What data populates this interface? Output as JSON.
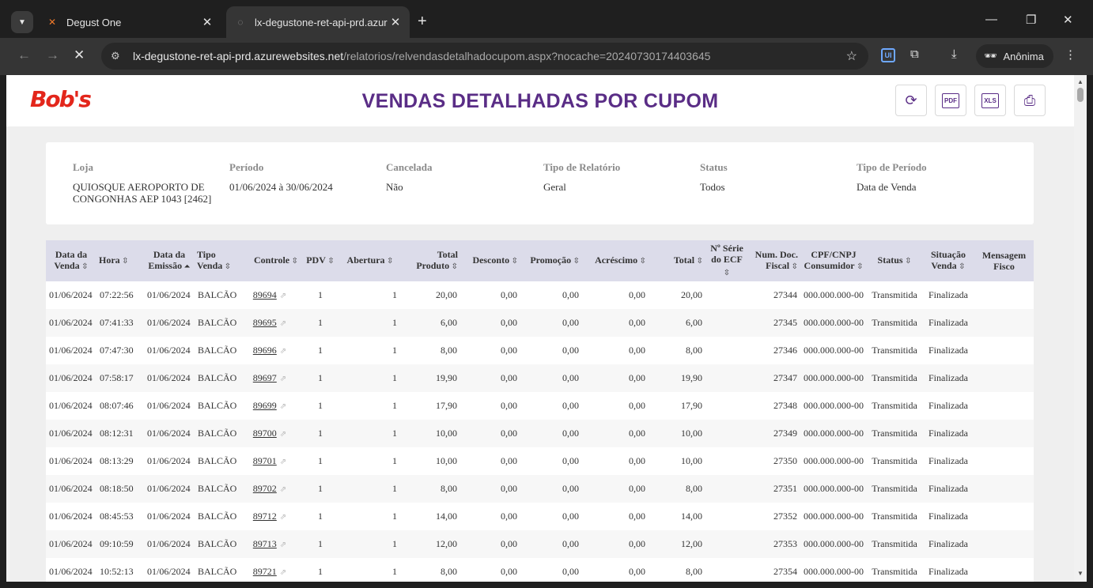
{
  "browser": {
    "tabs": [
      {
        "title": "Degust One",
        "active": false
      },
      {
        "title": "lx-degustone-ret-api-prd.azurew",
        "active": true
      }
    ],
    "url_host": "lx-degustone-ret-api-prd.azurewebsites.net",
    "url_path": "/relatorios/relvendasdetalhadocupom.aspx?nocache=20240730174403645",
    "profile_label": "Anônima",
    "ext_badge": "UI"
  },
  "header": {
    "logo_text": "Bob's",
    "title": "VENDAS DETALHADAS POR CUPOM",
    "pdf_label": "PDF",
    "xls_label": "XLS"
  },
  "filters": [
    {
      "label": "Loja",
      "value": "QUIOSQUE AEROPORTO DE CONGONHAS AEP 1043 [2462]"
    },
    {
      "label": "Período",
      "value": "01/06/2024 à 30/06/2024"
    },
    {
      "label": "Cancelada",
      "value": "Não"
    },
    {
      "label": "Tipo de Relatório",
      "value": "Geral"
    },
    {
      "label": "Status",
      "value": "Todos"
    },
    {
      "label": "Tipo de Período",
      "value": "Data de Venda"
    }
  ],
  "table": {
    "columns": [
      {
        "l1": "Data da",
        "l2": "Venda"
      },
      {
        "l1": "Hora",
        "l2": ""
      },
      {
        "l1": "Data da",
        "l2": "Emissão"
      },
      {
        "l1": "Tipo",
        "l2": "Venda"
      },
      {
        "l1": "Controle",
        "l2": ""
      },
      {
        "l1": "PDV",
        "l2": ""
      },
      {
        "l1": "Abertura",
        "l2": ""
      },
      {
        "l1": "Total",
        "l2": "Produto"
      },
      {
        "l1": "Desconto",
        "l2": ""
      },
      {
        "l1": "Promoção",
        "l2": ""
      },
      {
        "l1": "Acréscimo",
        "l2": ""
      },
      {
        "l1": "Total",
        "l2": ""
      },
      {
        "l1": "Nº Série",
        "l2": "do ECF"
      },
      {
        "l1": "Num. Doc.",
        "l2": "Fiscal"
      },
      {
        "l1": "CPF/CNPJ",
        "l2": "Consumidor"
      },
      {
        "l1": "Status",
        "l2": ""
      },
      {
        "l1": "Situação",
        "l2": "Venda"
      },
      {
        "l1": "Mensagem",
        "l2": "Fisco"
      }
    ],
    "rows": [
      [
        "01/06/2024",
        "07:22:56",
        "01/06/2024",
        "BALCÃO",
        "89694",
        "1",
        "1",
        "20,00",
        "0,00",
        "0,00",
        "0,00",
        "20,00",
        "",
        "27344",
        "000.000.000-00",
        "Transmitida",
        "Finalizada",
        ""
      ],
      [
        "01/06/2024",
        "07:41:33",
        "01/06/2024",
        "BALCÃO",
        "89695",
        "1",
        "1",
        "6,00",
        "0,00",
        "0,00",
        "0,00",
        "6,00",
        "",
        "27345",
        "000.000.000-00",
        "Transmitida",
        "Finalizada",
        ""
      ],
      [
        "01/06/2024",
        "07:47:30",
        "01/06/2024",
        "BALCÃO",
        "89696",
        "1",
        "1",
        "8,00",
        "0,00",
        "0,00",
        "0,00",
        "8,00",
        "",
        "27346",
        "000.000.000-00",
        "Transmitida",
        "Finalizada",
        ""
      ],
      [
        "01/06/2024",
        "07:58:17",
        "01/06/2024",
        "BALCÃO",
        "89697",
        "1",
        "1",
        "19,90",
        "0,00",
        "0,00",
        "0,00",
        "19,90",
        "",
        "27347",
        "000.000.000-00",
        "Transmitida",
        "Finalizada",
        ""
      ],
      [
        "01/06/2024",
        "08:07:46",
        "01/06/2024",
        "BALCÃO",
        "89699",
        "1",
        "1",
        "17,90",
        "0,00",
        "0,00",
        "0,00",
        "17,90",
        "",
        "27348",
        "000.000.000-00",
        "Transmitida",
        "Finalizada",
        ""
      ],
      [
        "01/06/2024",
        "08:12:31",
        "01/06/2024",
        "BALCÃO",
        "89700",
        "1",
        "1",
        "10,00",
        "0,00",
        "0,00",
        "0,00",
        "10,00",
        "",
        "27349",
        "000.000.000-00",
        "Transmitida",
        "Finalizada",
        ""
      ],
      [
        "01/06/2024",
        "08:13:29",
        "01/06/2024",
        "BALCÃO",
        "89701",
        "1",
        "1",
        "10,00",
        "0,00",
        "0,00",
        "0,00",
        "10,00",
        "",
        "27350",
        "000.000.000-00",
        "Transmitida",
        "Finalizada",
        ""
      ],
      [
        "01/06/2024",
        "08:18:50",
        "01/06/2024",
        "BALCÃO",
        "89702",
        "1",
        "1",
        "8,00",
        "0,00",
        "0,00",
        "0,00",
        "8,00",
        "",
        "27351",
        "000.000.000-00",
        "Transmitida",
        "Finalizada",
        ""
      ],
      [
        "01/06/2024",
        "08:45:53",
        "01/06/2024",
        "BALCÃO",
        "89712",
        "1",
        "1",
        "14,00",
        "0,00",
        "0,00",
        "0,00",
        "14,00",
        "",
        "27352",
        "000.000.000-00",
        "Transmitida",
        "Finalizada",
        ""
      ],
      [
        "01/06/2024",
        "09:10:59",
        "01/06/2024",
        "BALCÃO",
        "89713",
        "1",
        "1",
        "12,00",
        "0,00",
        "0,00",
        "0,00",
        "12,00",
        "",
        "27353",
        "000.000.000-00",
        "Transmitida",
        "Finalizada",
        ""
      ],
      [
        "01/06/2024",
        "10:52:13",
        "01/06/2024",
        "BALCÃO",
        "89721",
        "1",
        "1",
        "8,00",
        "0,00",
        "0,00",
        "0,00",
        "8,00",
        "",
        "27354",
        "000.000.000-00",
        "Transmitida",
        "Finalizada",
        ""
      ]
    ]
  }
}
